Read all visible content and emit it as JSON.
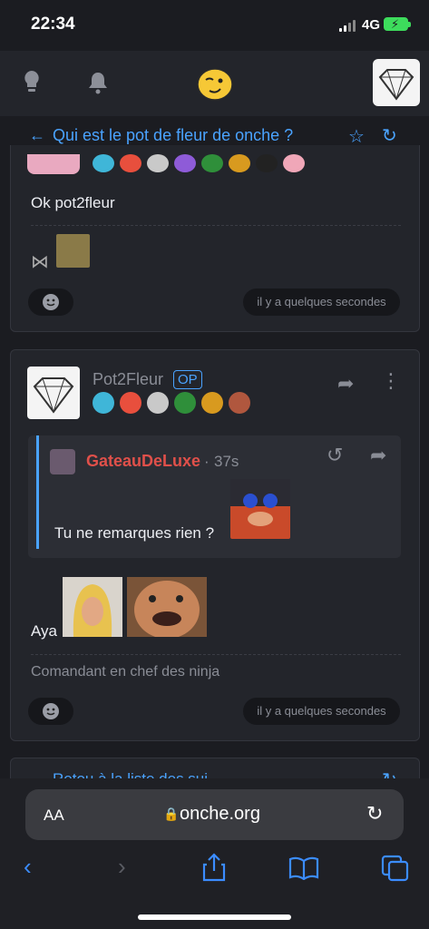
{
  "status": {
    "time": "22:34",
    "network": "4G"
  },
  "nav": {
    "icons": [
      "lightbulb-icon",
      "bell-icon",
      "smiley-logo-icon",
      "user-avatar"
    ]
  },
  "topic": {
    "title": "Qui est le pot de fleur de onche ?"
  },
  "post1": {
    "text": "Ok pot2fleur",
    "time": "il y a quelques secondes"
  },
  "post2": {
    "author": "Pot2Fleur",
    "op_badge": "OP",
    "quote": {
      "author": "GateauDeLuxe",
      "age": "37s",
      "text": "Tu ne remarques rien ?"
    },
    "text": "Aya",
    "signature": "Comandant en chef des ninja",
    "time": "il y a quelques secondes"
  },
  "footer_link": "Retou à la liste des sui",
  "browser": {
    "text_size": "AA",
    "url": "onche.org"
  },
  "colors": {
    "accent": "#4aa3ff",
    "author_red": "#e0504a",
    "background": "#1b1c21",
    "card": "#23252b"
  }
}
